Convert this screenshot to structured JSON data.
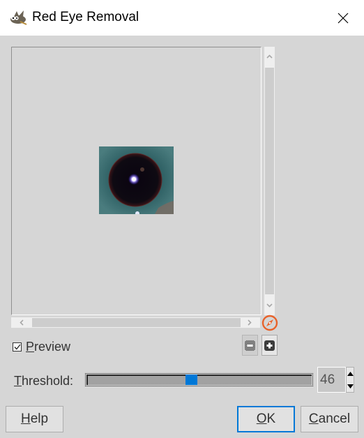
{
  "window": {
    "title": "Red Eye Removal",
    "app_icon": "gimp-wilber-icon",
    "close_icon": "close-icon"
  },
  "preview": {
    "image_description": "close-up of an eye with dark pupil and teal-blue iris",
    "checkbox_label_mnemonic": "P",
    "checkbox_label_rest": "review",
    "checked": true,
    "zoom_out_icon": "zoom-out-icon",
    "zoom_in_icon": "zoom-in-icon",
    "navigate_icon": "compass-navigate-icon"
  },
  "threshold": {
    "label_mnemonic": "T",
    "label_rest": "hreshold:",
    "value": "46",
    "min": 0,
    "max": 100,
    "slider_fraction": 0.46
  },
  "buttons": {
    "help_mnemonic": "H",
    "help_rest": "elp",
    "ok_mnemonic": "O",
    "ok_rest": "K",
    "cancel_mnemonic": "C",
    "cancel_rest": "ancel"
  },
  "colors": {
    "accent": "#0078d7",
    "nav_orange": "#e8622a",
    "dialog_bg": "#d6d6d6"
  }
}
